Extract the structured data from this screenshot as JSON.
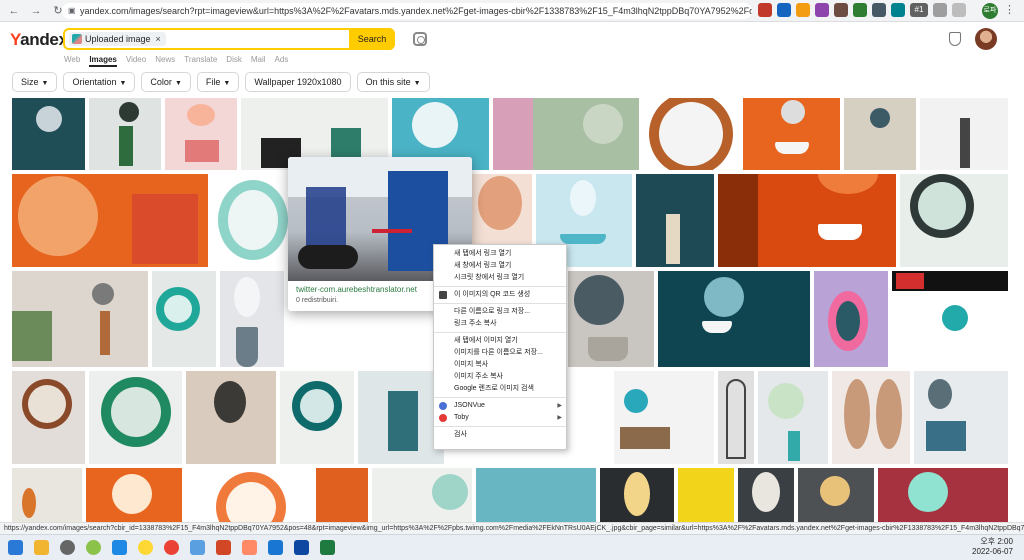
{
  "browser": {
    "url": "yandex.com/images/search?rpt=imageview&url=https%3A%2F%2Favatars.mds.yandex.net%2Fget-images-cbir%2F1338783%2F15_F4m3lhqN2tppDBq70YA7952%2Forig&cbir_id=1338783%2F15_F4m3lhqN2tppDBq70YA7952%2Forig",
    "nav": {
      "back": "←",
      "forward": "→",
      "reload": "↻",
      "lock": "🔒"
    },
    "extensions": [
      "#1"
    ],
    "profile_label": "로파",
    "menu": "⋮"
  },
  "header": {
    "logo_first": "Y",
    "logo_rest": "andex",
    "search_chip": "Uploaded image",
    "chip_close": "×",
    "search_button": "Search",
    "tabs": [
      {
        "label": "Web"
      },
      {
        "label": "Images"
      },
      {
        "label": "Video"
      },
      {
        "label": "News"
      },
      {
        "label": "Translate"
      },
      {
        "label": "Disk"
      },
      {
        "label": "Mail"
      },
      {
        "label": "Ads"
      }
    ]
  },
  "filters": [
    {
      "label": "Size",
      "dropdown": true
    },
    {
      "label": "Orientation",
      "dropdown": true
    },
    {
      "label": "Color",
      "dropdown": true
    },
    {
      "label": "File",
      "dropdown": true
    },
    {
      "label": "Wallpaper 1920x1080",
      "dropdown": false
    },
    {
      "label": "On this site",
      "dropdown": true
    }
  ],
  "hover_card": {
    "title": "twitter-com.aurebeshtranslator.net",
    "subtitle": "0 redistribuiri."
  },
  "context_menu": {
    "items": [
      {
        "label": "새 탭에서 링크 열기"
      },
      {
        "label": "새 창에서 링크 열기"
      },
      {
        "label": "시크릿 창에서 링크 열기"
      },
      {
        "sep": true
      },
      {
        "label": "이 이미지의 QR 코드 생성",
        "icon": "qr"
      },
      {
        "sep": true
      },
      {
        "label": "다른 이름으로 링크 저장..."
      },
      {
        "label": "링크 주소 복사"
      },
      {
        "sep": true
      },
      {
        "label": "새 탭에서 이미지 열기"
      },
      {
        "label": "이미지를 다른 이름으로 저장..."
      },
      {
        "label": "이미지 복사"
      },
      {
        "label": "이미지 주소 복사"
      },
      {
        "label": "Google 렌즈로 이미지 검색"
      },
      {
        "sep": true
      },
      {
        "label": "JSONVue",
        "icon": "jsonvue",
        "submenu": true
      },
      {
        "label": "Toby",
        "icon": "toby",
        "submenu": true
      },
      {
        "sep": true
      },
      {
        "label": "검사"
      }
    ]
  },
  "status_url": "https://yandex.com/images/search?cbir_id=1338783%2F15_F4m3lhqN2tppDBq70YA7952&pos=48&rpt=imageview&img_url=https%3A%2F%2Fpbs.twimg.com%2Fmedia%2FEkNnTRsU0AEjCK_.jpg&cbir_page=similar&url=https%3A%2F%2Favatars.mds.yandex.net%2Fget-images-cbir%2F1338783%2F15_F4m3lhqN2tppDBq70YA7952%2Forig",
  "taskbar": {
    "time": "오후 2:00",
    "date": "2022-06-07"
  },
  "colors": {
    "accent": "#ffcc00",
    "yandex_red": "#fc3f1d"
  }
}
